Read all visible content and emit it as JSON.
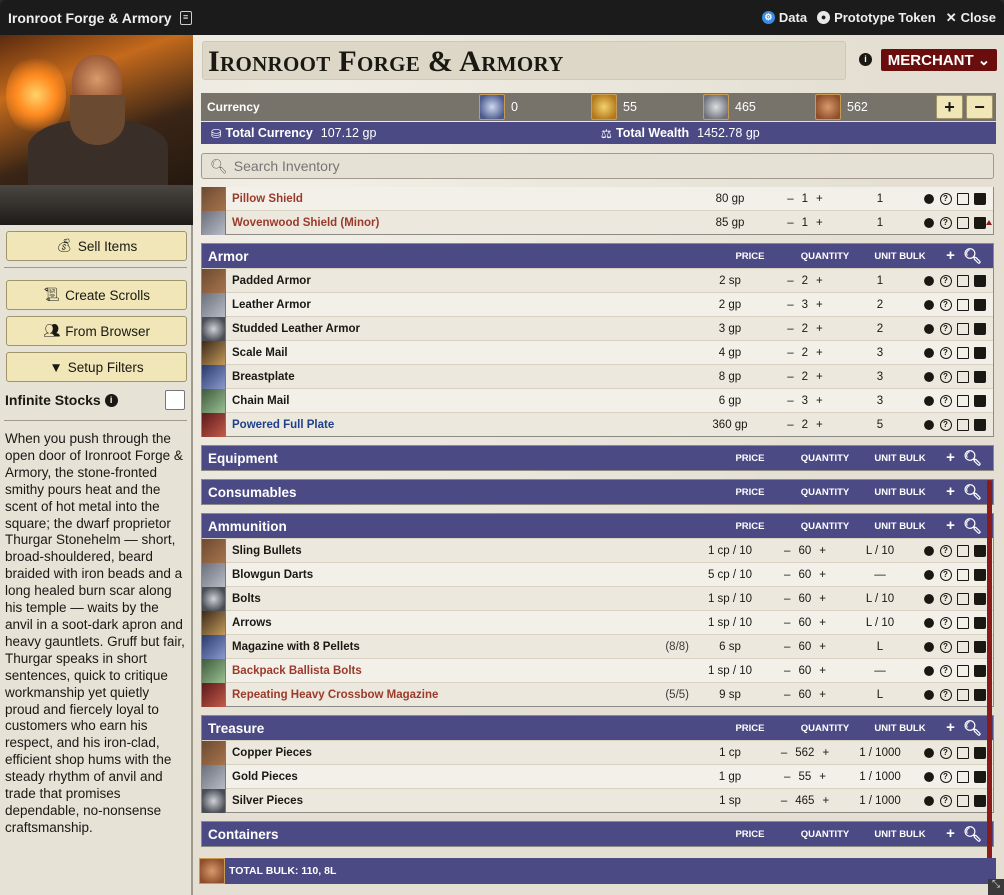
{
  "window": {
    "title": "Ironroot Forge & Armory",
    "data_label": "Data",
    "prototype_label": "Prototype Token",
    "close_label": "Close"
  },
  "sidebar": {
    "buttons": {
      "sell": "Sell Items",
      "scrolls": "Create Scrolls",
      "browser": "From Browser",
      "filters": "Setup Filters"
    },
    "infinite_label": "Infinite Stocks",
    "description": "When you push through the open door of Ironroot Forge & Armory, the stone-fronted smithy pours heat and the scent of hot metal into the square; the dwarf proprietor Thurgar Stonehelm — short, broad-shouldered, beard braided with iron beads and a long healed burn scar along his temple — waits by the anvil in a soot-dark apron and heavy gauntlets. Gruff but fair, Thurgar speaks in short sentences, quick to critique workmanship yet quietly proud and fiercely loyal to customers who earn his respect, and his iron-clad, efficient shop hums with the steady rhythm of anvil and trade that promises dependable, no-nonsense craftsmanship."
  },
  "header": {
    "name": "Ironroot Forge & Armory",
    "mode": "MERCHANT"
  },
  "currency": {
    "label": "Currency",
    "pp": "0",
    "gp": "55",
    "sp": "465",
    "cp": "562",
    "total_currency_label": "Total Currency",
    "total_currency": "107.12 gp",
    "total_wealth_label": "Total Wealth",
    "total_wealth": "1452.78 gp"
  },
  "search": {
    "placeholder": "Search Inventory"
  },
  "columns": {
    "price": "PRICE",
    "quantity": "QUANTITY",
    "bulk": "UNIT BULK"
  },
  "groups": {
    "shields_partial": [
      {
        "name": "Pillow Shield",
        "price": "80 gp",
        "qty": "1",
        "bulk": "1",
        "style": "red"
      },
      {
        "name": "Wovenwood Shield (Minor)",
        "price": "85 gp",
        "qty": "1",
        "bulk": "1",
        "style": "red"
      }
    ],
    "armor": {
      "title": "Armor",
      "items": [
        {
          "name": "Padded Armor",
          "price": "2 sp",
          "qty": "2",
          "bulk": "1"
        },
        {
          "name": "Leather Armor",
          "price": "2 gp",
          "qty": "3",
          "bulk": "2"
        },
        {
          "name": "Studded Leather Armor",
          "price": "3 gp",
          "qty": "2",
          "bulk": "2"
        },
        {
          "name": "Scale Mail",
          "price": "4 gp",
          "qty": "2",
          "bulk": "3"
        },
        {
          "name": "Breastplate",
          "price": "8 gp",
          "qty": "2",
          "bulk": "3"
        },
        {
          "name": "Chain Mail",
          "price": "6 gp",
          "qty": "3",
          "bulk": "3"
        },
        {
          "name": "Powered Full Plate",
          "price": "360 gp",
          "qty": "2",
          "bulk": "5",
          "style": "blue"
        }
      ]
    },
    "equipment": {
      "title": "Equipment"
    },
    "consumables": {
      "title": "Consumables"
    },
    "ammunition": {
      "title": "Ammunition",
      "items": [
        {
          "name": "Sling Bullets",
          "charges": "",
          "price": "1 cp / 10",
          "qty": "60",
          "bulk": "L / 10"
        },
        {
          "name": "Blowgun Darts",
          "charges": "",
          "price": "5 cp / 10",
          "qty": "60",
          "bulk": "—"
        },
        {
          "name": "Bolts",
          "charges": "",
          "price": "1 sp / 10",
          "qty": "60",
          "bulk": "L / 10"
        },
        {
          "name": "Arrows",
          "charges": "",
          "price": "1 sp / 10",
          "qty": "60",
          "bulk": "L / 10"
        },
        {
          "name": "Magazine with 8 Pellets",
          "charges": "(8/8)",
          "price": "6 sp",
          "qty": "60",
          "bulk": "L"
        },
        {
          "name": "Backpack Ballista Bolts",
          "charges": "",
          "price": "1 sp / 10",
          "qty": "60",
          "bulk": "—",
          "style": "red"
        },
        {
          "name": "Repeating Heavy Crossbow Magazine",
          "charges": "(5/5)",
          "price": "9 sp",
          "qty": "60",
          "bulk": "L",
          "style": "red"
        }
      ]
    },
    "treasure": {
      "title": "Treasure",
      "items": [
        {
          "name": "Copper Pieces",
          "price": "1 cp",
          "qty": "562",
          "bulk": "1 / 1000"
        },
        {
          "name": "Gold Pieces",
          "price": "1 gp",
          "qty": "55",
          "bulk": "1 / 1000"
        },
        {
          "name": "Silver Pieces",
          "price": "1 sp",
          "qty": "465",
          "bulk": "1 / 1000"
        }
      ]
    },
    "containers": {
      "title": "Containers"
    }
  },
  "footer": {
    "total_bulk": "TOTAL BULK: 110, 8L"
  },
  "colors": {
    "header_band": "#4b4a85",
    "merchant_badge": "#6a0d0d",
    "button_bg": "#f0e6b8",
    "item_red": "#9b3a2a",
    "item_blue": "#1f3f8a"
  }
}
